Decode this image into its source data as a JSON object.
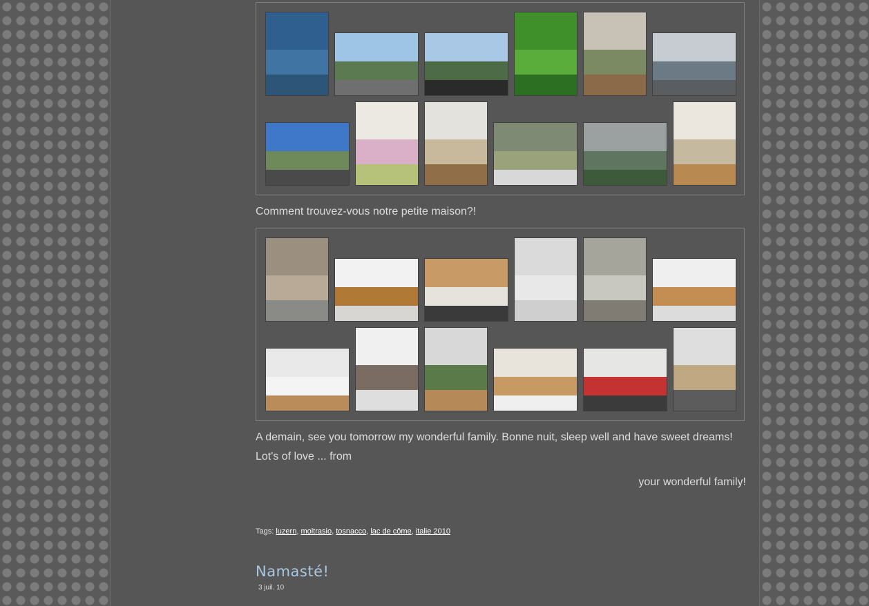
{
  "gallery1": {
    "photos": [
      {
        "name": "photo-satellite-map",
        "colors": [
          "#2f5f8f",
          "#3f74a3",
          "#2d5578"
        ]
      },
      {
        "name": "photo-highway-mountains",
        "colors": [
          "#9ec4e6",
          "#5c7a52",
          "#6f6f6f"
        ]
      },
      {
        "name": "photo-car-dashboard-road",
        "colors": [
          "#a8c8e6",
          "#4d6b46",
          "#2a2a2a"
        ]
      },
      {
        "name": "photo-grape-leaves",
        "colors": [
          "#3f8f2a",
          "#5aad3a",
          "#2c6e22"
        ]
      },
      {
        "name": "photo-stone-house-children",
        "colors": [
          "#c8c2b6",
          "#7b8a63",
          "#8a6a48"
        ]
      },
      {
        "name": "photo-valley-clouds",
        "colors": [
          "#c7ccd2",
          "#6c7a86",
          "#5a5e60"
        ]
      },
      {
        "name": "photo-highway-blue-sky",
        "colors": [
          "#3f78c8",
          "#6f8a5a",
          "#4a4a4a"
        ]
      },
      {
        "name": "photo-tulip-painting",
        "colors": [
          "#ece8e2",
          "#d9b0c8",
          "#b6c27a"
        ]
      },
      {
        "name": "photo-staircase",
        "colors": [
          "#e4e2dc",
          "#c8b89c",
          "#8f6e48"
        ]
      },
      {
        "name": "photo-flags-vineyard",
        "colors": [
          "#7f8a74",
          "#9aa27c",
          "#d8d8d8"
        ]
      },
      {
        "name": "photo-rainbow-hills",
        "colors": [
          "#9aa1a0",
          "#5f7560",
          "#3d5a3a"
        ]
      },
      {
        "name": "photo-bedroom-double-bed",
        "colors": [
          "#ebe7df",
          "#c5b9a0",
          "#b88a52"
        ]
      }
    ]
  },
  "caption1": "Comment trouvez-vous notre petite maison?!",
  "gallery2": {
    "photos": [
      {
        "name": "photo-bathroom-toilet",
        "colors": [
          "#9b8f80",
          "#b8aa96",
          "#8a8a86"
        ]
      },
      {
        "name": "photo-window-shutters",
        "colors": [
          "#f2f2f2",
          "#b07a36",
          "#d8d6d2"
        ]
      },
      {
        "name": "photo-bedroom-bedspread",
        "colors": [
          "#c79a66",
          "#e6e2dc",
          "#3a3a3a"
        ]
      },
      {
        "name": "photo-hallway-door",
        "colors": [
          "#dadada",
          "#e8e8e8",
          "#cfcfcf"
        ]
      },
      {
        "name": "photo-shower-room",
        "colors": [
          "#a6a59c",
          "#c9c8c0",
          "#807c74"
        ]
      },
      {
        "name": "photo-kitchen-cabinets",
        "colors": [
          "#efefef",
          "#c48e52",
          "#dcdcdc"
        ]
      },
      {
        "name": "photo-bedroom-window",
        "colors": [
          "#e9e9e9",
          "#f4f4f4",
          "#b98c5a"
        ]
      },
      {
        "name": "photo-open-window-view",
        "colors": [
          "#f0f0f0",
          "#7a6c62",
          "#dedede"
        ]
      },
      {
        "name": "photo-balcony-door",
        "colors": [
          "#d8d8d8",
          "#5a7a4a",
          "#b58a58"
        ]
      },
      {
        "name": "photo-girl-kitchen-table",
        "colors": [
          "#e8e4dc",
          "#c69a62",
          "#efefef"
        ]
      },
      {
        "name": "photo-living-red-sofa",
        "colors": [
          "#e6e6e4",
          "#c43232",
          "#3b3b3b"
        ]
      },
      {
        "name": "photo-living-stairs-tv",
        "colors": [
          "#dedede",
          "#c0a882",
          "#5c5c5c"
        ]
      }
    ]
  },
  "paragraph": "A demain, see you tomorrow my wonderful family. Bonne nuit, sleep well and have sweet dreams! Lot's of love ... from",
  "signature": "your wonderful family!",
  "tags": {
    "label": "Tags:",
    "items": [
      "luzern",
      "moltrasio",
      "tosnacco",
      "lac de côme",
      "italie 2010"
    ]
  },
  "next_post": {
    "title": "Namasté!",
    "date": "3 juil. 10"
  }
}
